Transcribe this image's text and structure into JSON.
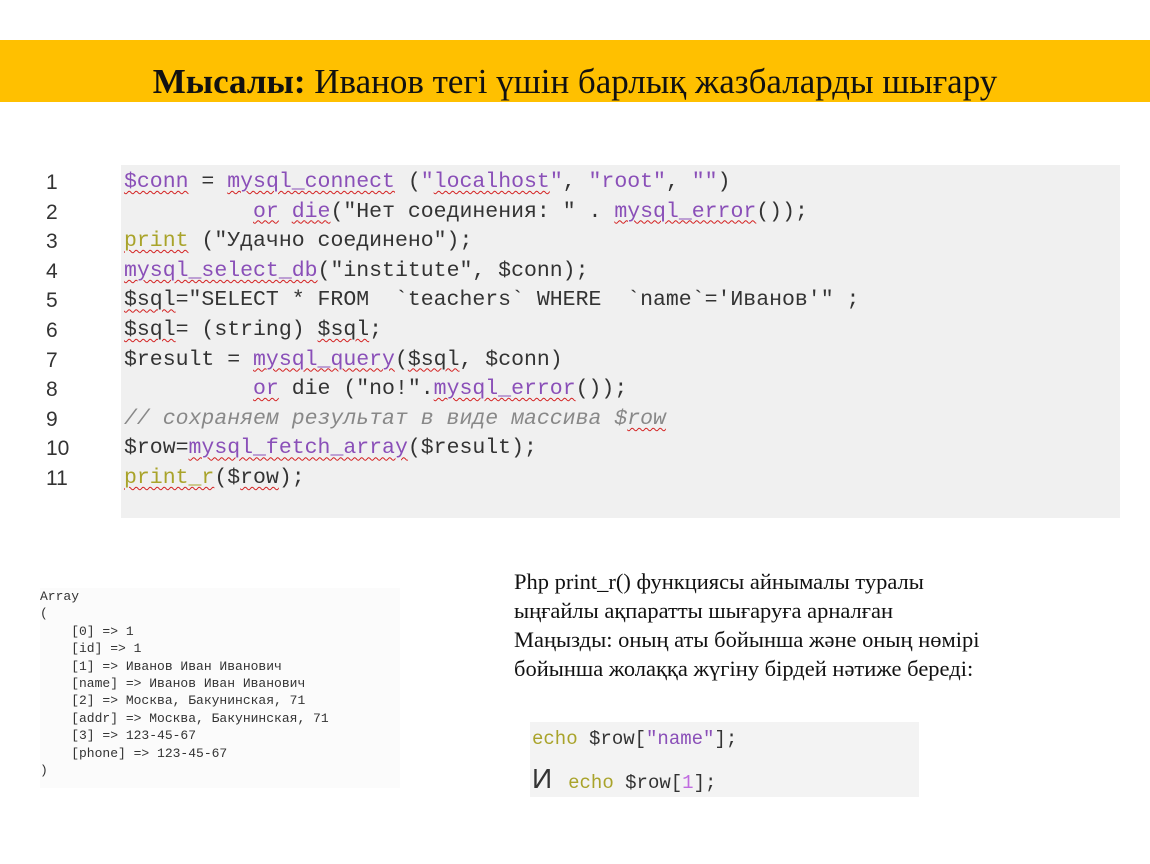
{
  "title": {
    "bold": "Мысалы:",
    "text": " Иванов тегі үшін барлық жазбаларды шығару"
  },
  "code": {
    "line_numbers": [
      "1",
      "2",
      "3",
      "4",
      "5",
      "6",
      "7",
      "8",
      "9",
      "10",
      "11"
    ]
  },
  "output_lines": [
    "Array",
    "(",
    "    [0] => 1",
    "    [id] => 1",
    "    [1] => Иванов Иван Иванович",
    "    [name] => Иванов Иван Иванович",
    "    [2] => Москва, Бакунинская, 71",
    "    [addr] => Москва, Бакунинская, 71",
    "    [3] => 123-45-67",
    "    [phone] => 123-45-67",
    ")"
  ],
  "description": [
    "Php print_r() функциясы айнымалы туралы",
    "ыңғайлы ақпаратты шығаруға арналған",
    "Маңызды: оның аты бойынша және оның нөмірі",
    "бойынша жолаққа жүгіну бірдей нәтиже береді:"
  ],
  "echo_example": {
    "conj": "И"
  },
  "colors": {
    "title_bar": "#ffc000",
    "keyword": "#8a4fb8",
    "function_yellow": "#a9a32a",
    "comment": "#888888"
  }
}
